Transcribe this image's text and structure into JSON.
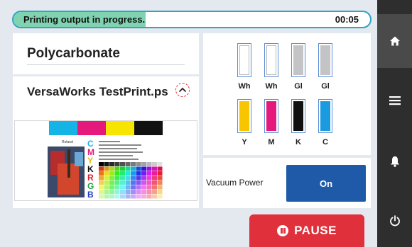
{
  "status": {
    "text": "Printing output in progress.",
    "time": "00:05",
    "progress": 0.37
  },
  "media": {
    "name": "Polycarbonate"
  },
  "job": {
    "name": "VersaWorks TestPrint.ps"
  },
  "preview": {
    "brand": "Roland",
    "cmykrgb": [
      "C",
      "M",
      "Y",
      "K",
      "R",
      "G",
      "B"
    ]
  },
  "inks": [
    {
      "label": "Wh",
      "color": "#ffffff"
    },
    {
      "label": "Wh",
      "color": "#ffffff"
    },
    {
      "label": "Gl",
      "color": "#c4c4c6"
    },
    {
      "label": "Gl",
      "color": "#c4c4c6"
    },
    {
      "label": "Y",
      "color": "#f7c600"
    },
    {
      "label": "M",
      "color": "#e5197b"
    },
    {
      "label": "K",
      "color": "#111111"
    },
    {
      "label": "C",
      "color": "#1a9be0"
    }
  ],
  "vacuum": {
    "label": "Vacuum Power",
    "state": "On"
  },
  "pause": {
    "label": "PAUSE"
  },
  "nav": [
    "home-icon",
    "menu-icon",
    "bell-icon",
    "power-icon"
  ],
  "colors": {
    "accent": "#1e5aa8",
    "pause": "#e0303c",
    "progress": "#7fd3b0",
    "nav": "#2e2e2e"
  }
}
